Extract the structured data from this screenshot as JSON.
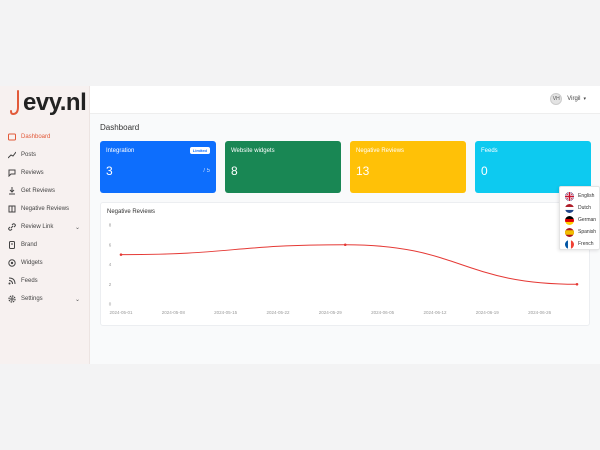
{
  "brand": {
    "name": "evy.nl",
    "accent": "#e25a3a"
  },
  "sidebar": {
    "items": [
      {
        "label": "Dashboard",
        "icon": "dashboard-icon",
        "active": true
      },
      {
        "label": "Posts",
        "icon": "trend-icon"
      },
      {
        "label": "Reviews",
        "icon": "chat-icon"
      },
      {
        "label": "Get Reviews",
        "icon": "download-icon"
      },
      {
        "label": "Negative Reviews",
        "icon": "book-icon"
      },
      {
        "label": "Review Link",
        "icon": "link-icon",
        "expandable": true
      },
      {
        "label": "Brand",
        "icon": "brand-icon"
      },
      {
        "label": "Widgets",
        "icon": "widget-icon"
      },
      {
        "label": "Feeds",
        "icon": "feed-icon"
      },
      {
        "label": "Settings",
        "icon": "gear-icon",
        "expandable": true
      }
    ]
  },
  "header": {
    "avatar": "VH",
    "user_name": "Virgil"
  },
  "main": {
    "title": "Dashboard",
    "cards": [
      {
        "title": "Integration",
        "value": "3",
        "badge": "Limited",
        "limit": "/ 5",
        "color": "#0d6efd"
      },
      {
        "title": "Website widgets",
        "value": "8",
        "color": "#198754"
      },
      {
        "title": "Negative Reviews",
        "value": "13",
        "color": "#ffc107"
      },
      {
        "title": "Feeds",
        "value": "0",
        "color": "#0dcaf0"
      }
    ]
  },
  "chart_data": {
    "type": "line",
    "title": "Negative Reviews",
    "x": [
      "2024-05-01",
      "2024-05-08",
      "2024-05-15",
      "2024-05-22",
      "2024-05-29",
      "2024-06-05",
      "2024-06-12",
      "2024-06-19",
      "2024-06-26"
    ],
    "points": [
      {
        "x": "2024-05-01",
        "y": 5
      },
      {
        "x": "2024-05-31",
        "y": 6
      },
      {
        "x": "2024-07-01",
        "y": 2
      }
    ],
    "ylim": [
      0,
      8
    ],
    "yticks": [
      0,
      2,
      4,
      6,
      8
    ],
    "color": "#e53935",
    "grid": false
  },
  "languages": [
    {
      "label": "English",
      "flag": "uk-flag-icon"
    },
    {
      "label": "Dutch",
      "flag": "nl-flag-icon"
    },
    {
      "label": "German",
      "flag": "de-flag-icon"
    },
    {
      "label": "Spanish",
      "flag": "es-flag-icon"
    },
    {
      "label": "French",
      "flag": "fr-flag-icon"
    }
  ]
}
